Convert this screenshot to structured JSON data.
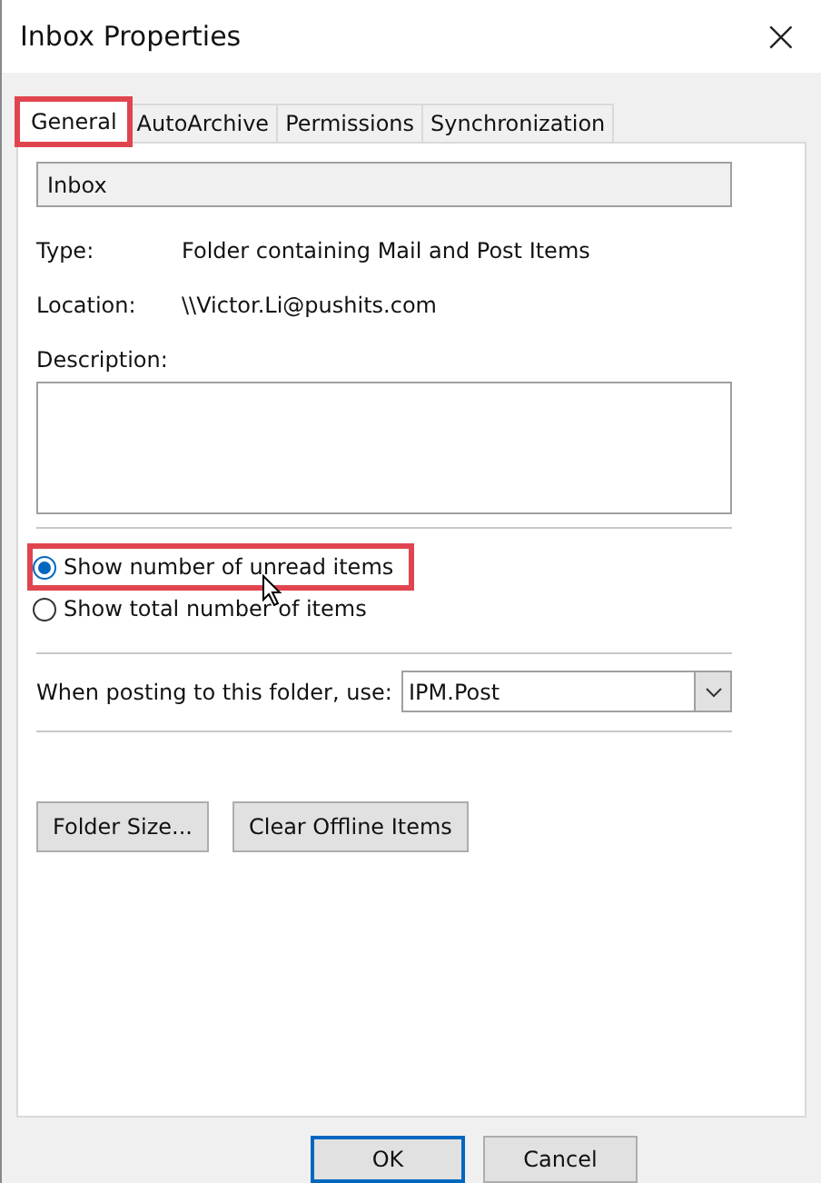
{
  "window": {
    "title": "Inbox Properties",
    "close": "×"
  },
  "tabs": [
    {
      "label": "General",
      "selected": true,
      "highlighted": true
    },
    {
      "label": "AutoArchive",
      "selected": false,
      "highlighted": false
    },
    {
      "label": "Permissions",
      "selected": false,
      "highlighted": false
    },
    {
      "label": "Synchronization",
      "selected": false,
      "highlighted": false
    }
  ],
  "name_field": {
    "value": "Inbox"
  },
  "properties": [
    {
      "label": "Type:",
      "value": "Folder containing Mail and Post Items"
    },
    {
      "label": "Location:",
      "value": "\\\\Victor.Li@pushits.com"
    }
  ],
  "description": {
    "label": "Description:"
  },
  "count_options": [
    {
      "label": "Show number of unread items",
      "selected": true,
      "highlighted": true
    },
    {
      "label": "Show total number of items",
      "selected": false,
      "highlighted": false
    }
  ],
  "posting": {
    "label": "When posting to this folder, use:",
    "value": "IPM.Post"
  },
  "folder_buttons": [
    "Folder Size...",
    "Clear Offline Items"
  ],
  "dialog_buttons": [
    {
      "label": "OK",
      "default": true
    },
    {
      "label": "Cancel",
      "default": false
    }
  ]
}
